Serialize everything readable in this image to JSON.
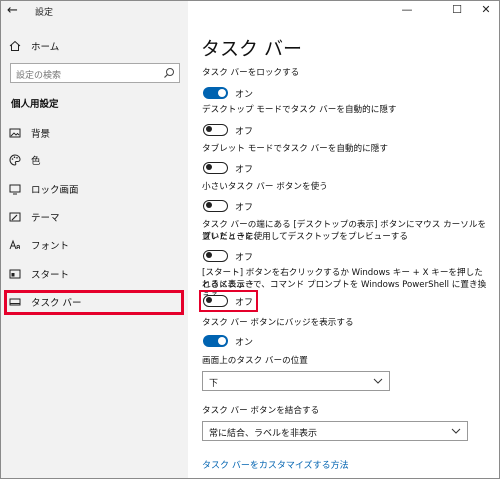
{
  "window": {
    "title": "設定",
    "back": "←",
    "minimize": "—",
    "maximize": "☐",
    "close": "✕"
  },
  "sidebar": {
    "home_label": "ホーム",
    "search_placeholder": "設定の検索",
    "section_title": "個人用設定",
    "items": [
      {
        "label": "背景",
        "icon": "image-icon"
      },
      {
        "label": "色",
        "icon": "palette-icon"
      },
      {
        "label": "ロック画面",
        "icon": "lock-screen-icon"
      },
      {
        "label": "テーマ",
        "icon": "theme-icon"
      },
      {
        "label": "フォント",
        "icon": "font-icon"
      },
      {
        "label": "スタート",
        "icon": "start-icon"
      },
      {
        "label": "タスク バー",
        "icon": "taskbar-icon",
        "selected": true
      }
    ]
  },
  "main": {
    "title": "タスク バー",
    "settings": [
      {
        "label": "タスク バーをロックする",
        "state": "オン",
        "on": true
      },
      {
        "label": "デスクトップ モードでタスク バーを自動的に隠す",
        "state": "オフ",
        "on": false
      },
      {
        "label": "タブレット モードでタスク バーを自動的に隠す",
        "state": "オフ",
        "on": false
      },
      {
        "label": "小さいタスク バー ボタンを使う",
        "state": "オフ",
        "on": false
      },
      {
        "label_line1": "タスク バーの端にある [デスクトップの表示] ボタンにマウス カーソルを置いたときに、",
        "label_line2": "プレビューを使用してデスクトップをプレビューする",
        "state": "オフ",
        "on": false
      },
      {
        "label_line1": "[スタート] ボタンを右クリックするか Windows キー + X キーを押したときに表示さ",
        "label_line2": "れるメニューで、コマンド プロンプトを Windows PowerShell に置き換える",
        "state": "オフ",
        "on": false
      },
      {
        "label": "タスク バー ボタンにバッジを表示する",
        "state": "オン",
        "on": true
      }
    ],
    "position_label": "画面上のタスク バーの位置",
    "position_value": "下",
    "combine_label": "タスク バー ボタンを結合する",
    "combine_value": "常に結合、ラベルを非表示",
    "customize_link": "タスク バーをカスタマイズする方法"
  },
  "colors": {
    "accent": "#0063b1",
    "highlight": "#e5002b",
    "sidebar_bg": "#f2f2f2"
  }
}
